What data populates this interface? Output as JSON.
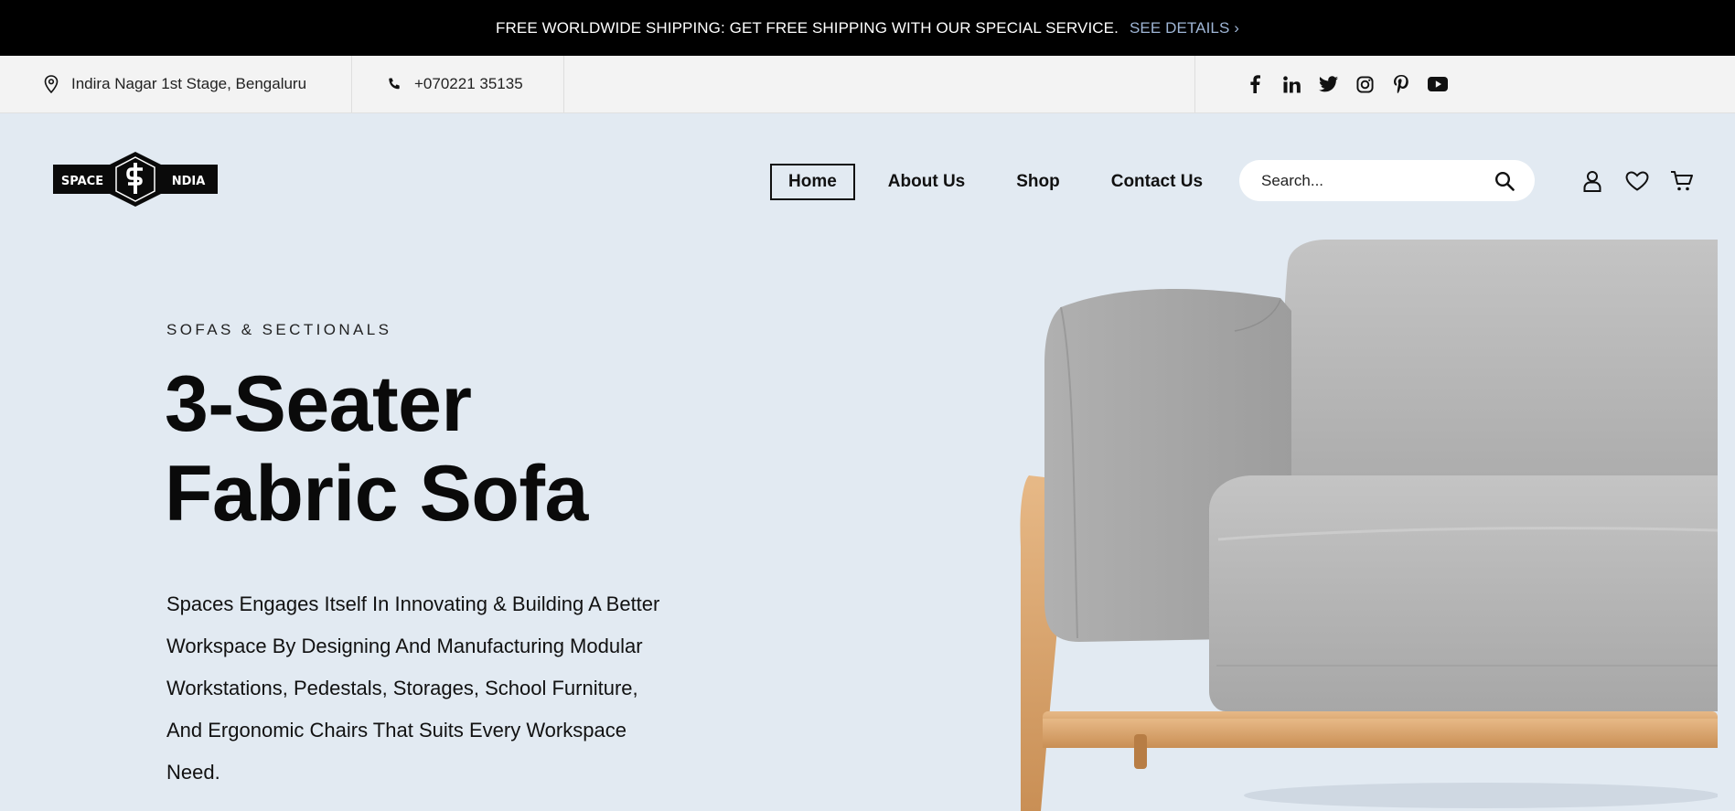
{
  "announcement": {
    "text": "FREE WORLDWIDE SHIPPING: GET FREE SHIPPING WITH OUR SPECIAL SERVICE.",
    "link": "SEE DETAILS ›"
  },
  "topbar": {
    "location": "Indira Nagar 1st Stage, Bengaluru",
    "phone": "+070221 35135",
    "social": [
      "facebook-icon",
      "linkedin-icon",
      "twitter-icon",
      "instagram-icon",
      "pinterest-icon",
      "youtube-icon"
    ]
  },
  "logo": {
    "left_text": "SPACE",
    "right_text": "NDIA"
  },
  "nav": {
    "items": [
      "Home",
      "About Us",
      "Shop",
      "Contact Us"
    ]
  },
  "search": {
    "placeholder": "Search..."
  },
  "hero": {
    "category": "SOFAS & SECTIONALS",
    "title_line1": "3-Seater",
    "title_line2": "Fabric Sofa",
    "description": "Spaces Engages Itself In Innovating & Building A Better Workspace By Designing And Manufacturing Modular Workstations, Pedestals, Storages, School Furniture, And Ergonomic Chairs That Suits Every Workspace Need."
  },
  "colors": {
    "announce_bg": "#000000",
    "details_link": "#9fb6d6",
    "hero_bg": "#e2eaf2",
    "sofa_fabric": "#b4b4b4",
    "sofa_wood": "#d9a76a"
  }
}
